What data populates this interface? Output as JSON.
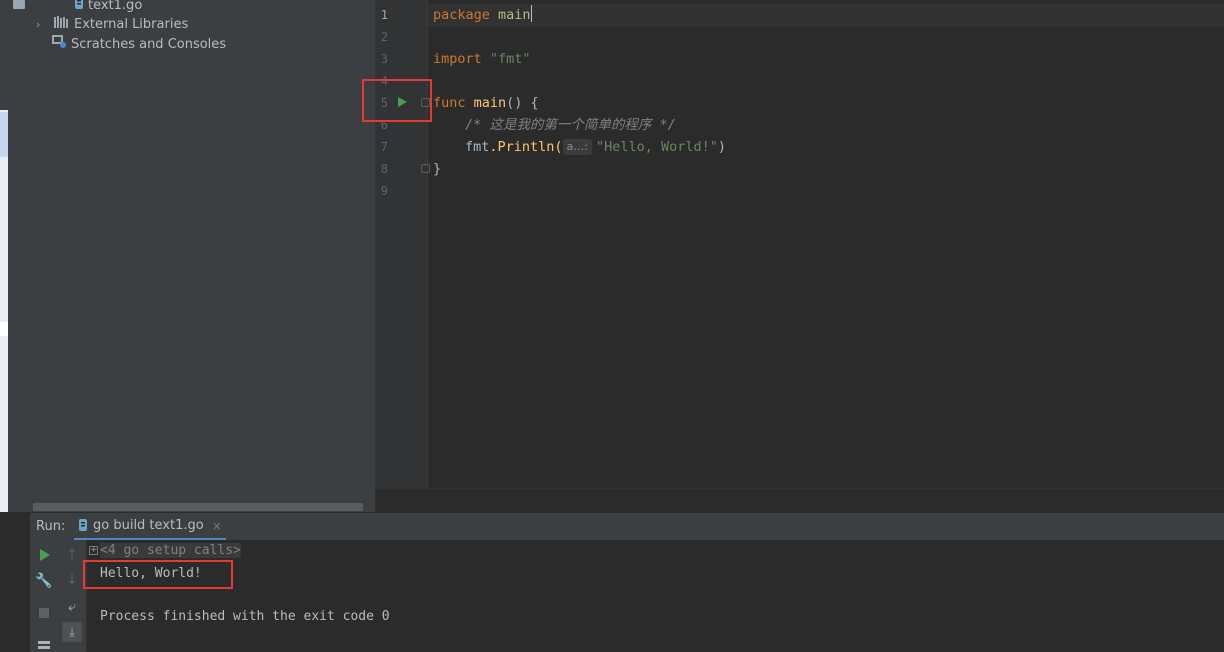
{
  "project_tree": {
    "items": [
      {
        "label": "text1.go",
        "icon": "go-file-icon"
      },
      {
        "label": "External Libraries",
        "icon": "library-icon"
      },
      {
        "label": "Scratches and Consoles",
        "icon": "scratches-icon"
      }
    ]
  },
  "editor": {
    "line_numbers": [
      "1",
      "2",
      "3",
      "4",
      "5",
      "6",
      "7",
      "8",
      "9"
    ],
    "code": {
      "line1_kw": "package",
      "line1_name": "main",
      "line3_kw": "import",
      "line3_str": "\"fmt\"",
      "line5_kw": "func",
      "line5_fn": "main",
      "line5_rest": "() {",
      "line6_comment": "/* 这是我的第一个简单的程序 */",
      "line7_pkg": "fmt",
      "line7_call": ".Println(",
      "line7_hint": "a…:",
      "line7_str": "\"Hello, World!\"",
      "line7_close": ")",
      "line8": "}"
    }
  },
  "run_panel": {
    "label": "Run:",
    "tab_label": "go build text1.go",
    "tab_close": "×",
    "console": {
      "setup_calls": "<4 go setup calls>",
      "output": "Hello, World!",
      "exit_message": "Process finished with the exit code 0"
    }
  },
  "colors": {
    "highlight_box": "#e53935",
    "run_green": "#499c54"
  }
}
